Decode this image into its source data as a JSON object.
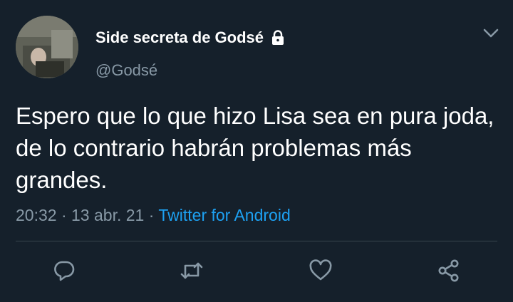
{
  "tweet": {
    "display_name": "Side secreta de Godsé",
    "handle": "@Godsé",
    "protected_icon": "lock-icon",
    "text": "Espero que lo que hizo Lisa sea en pura joda, de lo contrario habrán problemas más grandes.",
    "time": "20:32",
    "date": "13 abr. 21",
    "separator": "·",
    "source": "Twitter for Android"
  },
  "actions": {
    "reply_icon": "reply-icon",
    "retweet_icon": "retweet-icon",
    "like_icon": "heart-icon",
    "share_icon": "share-icon",
    "more_icon": "chevron-down-icon"
  },
  "colors": {
    "background": "#15202b",
    "primary_text": "#ffffff",
    "secondary_text": "#8899a6",
    "link": "#1da1f2",
    "divider": "#38444d"
  }
}
